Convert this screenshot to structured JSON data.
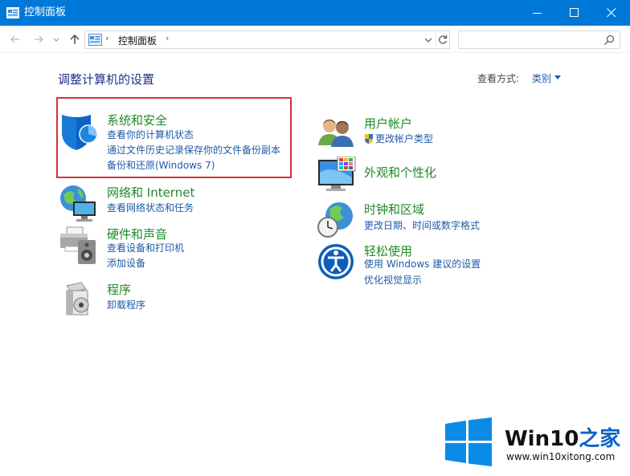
{
  "window": {
    "title": "控制面板"
  },
  "address": {
    "crumb": "控制面板",
    "separator": "›",
    "search_placeholder": ""
  },
  "main": {
    "heading": "调整计算机的设置",
    "view_by_label": "查看方式:",
    "view_by_value": "类别"
  },
  "categories_left": [
    {
      "name": "系统和安全",
      "links": [
        "查看你的计算机状态",
        "通过文件历史记录保存你的文件备份副本",
        "备份和还原(Windows 7)"
      ]
    },
    {
      "name": "网络和 Internet",
      "links": [
        "查看网络状态和任务"
      ]
    },
    {
      "name": "硬件和声音",
      "links": [
        "查看设备和打印机",
        "添加设备"
      ]
    },
    {
      "name": "程序",
      "links": [
        "卸载程序"
      ]
    }
  ],
  "categories_right": [
    {
      "name": "用户帐户",
      "links": [
        "更改帐户类型"
      ]
    },
    {
      "name": "外观和个性化",
      "links": []
    },
    {
      "name": "时钟和区域",
      "links": [
        "更改日期、时间或数字格式"
      ]
    },
    {
      "name": "轻松使用",
      "links": [
        "使用 Windows 建议的设置",
        "优化视觉显示"
      ]
    }
  ],
  "watermark": {
    "brand": "Win10",
    "brand_suffix": "之家",
    "url": "www.win10xitong.com"
  },
  "colors": {
    "titlebar": "#0078d7",
    "category_name": "#1e8a28",
    "link": "#1e5aa8",
    "heading": "#1e3287",
    "highlight": "#d13438"
  }
}
